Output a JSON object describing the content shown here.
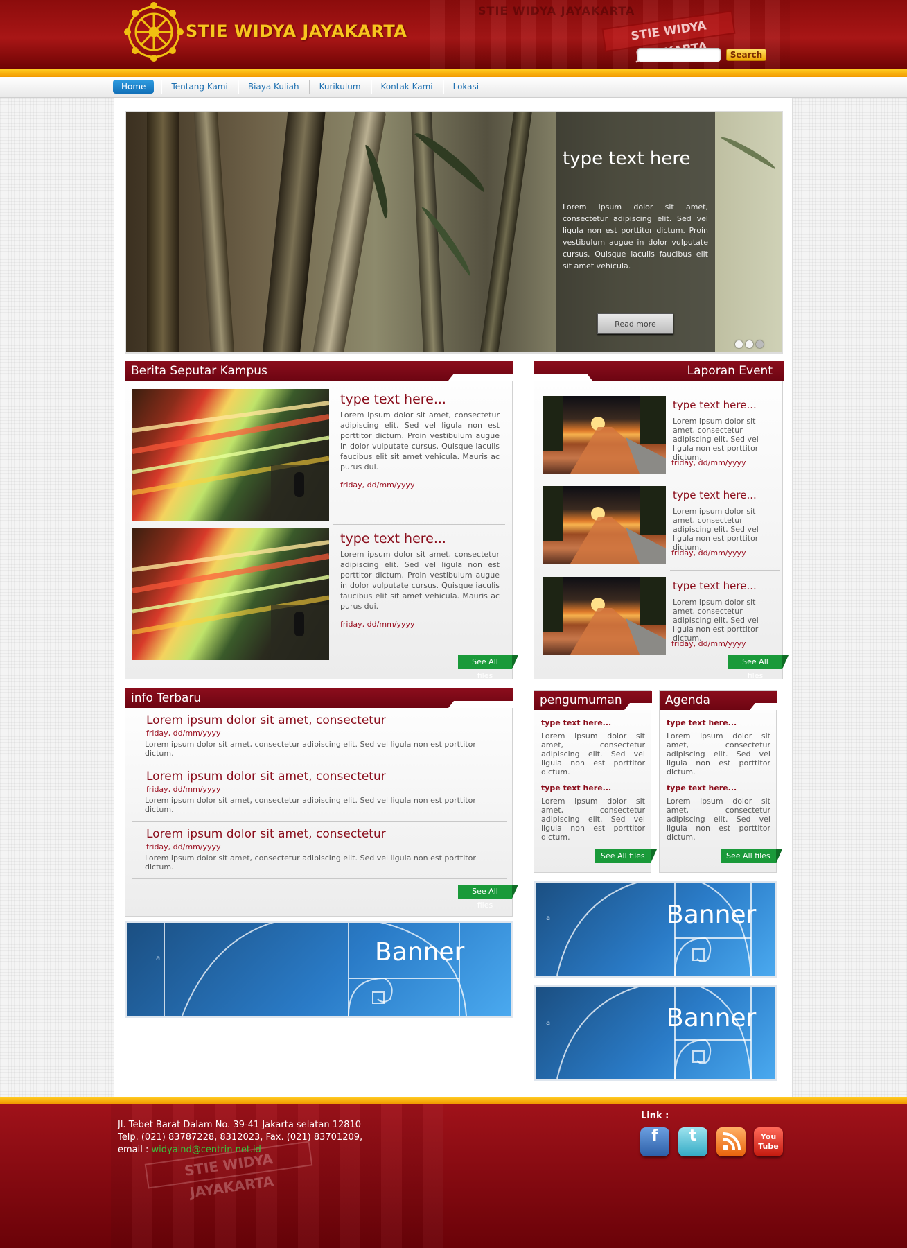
{
  "header": {
    "site_title": "STIE WIDYA JAYAKARTA",
    "search_placeholder": "",
    "search_label": "Search"
  },
  "nav": [
    "Home",
    "Tentang Kami",
    "Biaya Kuliah",
    "Kurikulum",
    "Kontak Kami",
    "Lokasi"
  ],
  "slider": {
    "title": "type text here",
    "text": "Lorem ipsum dolor sit amet, consectetur adipiscing elit. Sed vel ligula non est porttitor dictum. Proin vestibulum augue in dolor vulputate cursus. Quisque iaculis faucibus elit sit amet vehicula.",
    "read_more": "Read more"
  },
  "berita": {
    "heading": "Berita Seputar Kampus",
    "items": [
      {
        "title": "type text here...",
        "text": "Lorem ipsum dolor sit amet, consectetur adipiscing elit. Sed vel ligula non est porttitor dictum. Proin vestibulum augue in dolor vulputate cursus. Quisque iaculis faucibus elit sit amet vehicula. Mauris ac purus dui.",
        "date": "friday, dd/mm/yyyy"
      },
      {
        "title": "type text here...",
        "text": "Lorem ipsum dolor sit amet, consectetur adipiscing elit. Sed vel ligula non est porttitor dictum. Proin vestibulum augue in dolor vulputate cursus. Quisque iaculis faucibus elit sit amet vehicula. Mauris ac purus dui.",
        "date": "friday, dd/mm/yyyy"
      }
    ],
    "see_all": "See All files"
  },
  "laporan": {
    "heading": "Laporan Event",
    "items": [
      {
        "title": "type text here...",
        "text": "Lorem ipsum dolor sit amet, consectetur adipiscing elit. Sed vel ligula non est porttitor dictum.",
        "date": "friday, dd/mm/yyyy"
      },
      {
        "title": "type text here...",
        "text": "Lorem ipsum dolor sit amet, consectetur adipiscing elit. Sed vel ligula non est porttitor dictum.",
        "date": "friday, dd/mm/yyyy"
      },
      {
        "title": "type text here...",
        "text": "Lorem ipsum dolor sit amet, consectetur adipiscing elit. Sed vel ligula non est porttitor dictum.",
        "date": "friday, dd/mm/yyyy"
      }
    ],
    "see_all": "See All files"
  },
  "info": {
    "heading": "info Terbaru",
    "items": [
      {
        "title": "Lorem ipsum dolor sit amet, consectetur",
        "date": "friday, dd/mm/yyyy",
        "text": "Lorem ipsum dolor sit amet, consectetur adipiscing elit. Sed vel ligula non est porttitor dictum."
      },
      {
        "title": "Lorem ipsum dolor sit amet, consectetur",
        "date": "friday, dd/mm/yyyy",
        "text": "Lorem ipsum dolor sit amet, consectetur adipiscing elit. Sed vel ligula non est porttitor dictum."
      },
      {
        "title": "Lorem ipsum dolor sit amet, consectetur",
        "date": "friday, dd/mm/yyyy",
        "text": "Lorem ipsum dolor sit amet, consectetur adipiscing elit. Sed vel ligula non est porttitor dictum."
      }
    ],
    "see_all": "See All files"
  },
  "pengumuman": {
    "heading": "pengumuman",
    "items": [
      {
        "title": "type text here...",
        "text": "Lorem ipsum dolor sit amet, consectetur adipiscing elit. Sed vel ligula non est porttitor dictum."
      },
      {
        "title": "type text here...",
        "text": "Lorem ipsum dolor sit amet, consectetur adipiscing elit. Sed vel ligula non est porttitor dictum."
      }
    ],
    "see_all": "See All files"
  },
  "agenda": {
    "heading": "Agenda",
    "items": [
      {
        "title": "type text here...",
        "text": "Lorem ipsum dolor sit amet, consectetur adipiscing elit. Sed vel ligula non est porttitor dictum."
      },
      {
        "title": "type text here...",
        "text": "Lorem ipsum dolor sit amet, consectetur adipiscing elit. Sed vel ligula non est porttitor dictum."
      }
    ],
    "see_all": "See All files"
  },
  "banners": {
    "label": "Banner",
    "axis_letter": "a"
  },
  "footer": {
    "address_line1": "Jl. Tebet Barat Dalam No. 39-41 Jakarta selatan 12810",
    "address_line2": "Telp. (021) 83787228, 8312023, Fax. (021) 83701209,",
    "email_label": "email :",
    "email": "widyaind@centrin.net.id",
    "link_label": "Link :",
    "social": [
      "facebook-icon",
      "twitter-icon",
      "rss-icon",
      "youtube-icon"
    ]
  },
  "colors": {
    "brand_red": "#8b0d1c",
    "gold": "#f7c51e",
    "nav_blue": "#1c6fb0",
    "see_all_green": "#1a9a3a"
  }
}
